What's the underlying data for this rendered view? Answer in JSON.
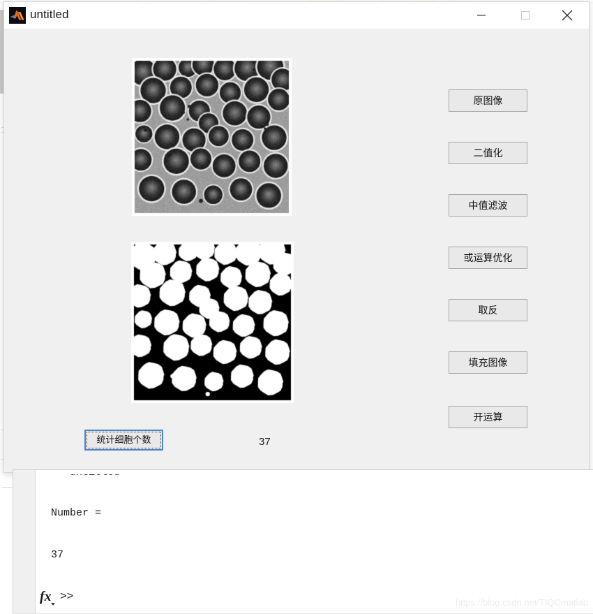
{
  "window": {
    "title": "untitled",
    "icon": "matlab-logo-icon",
    "controls": {
      "minimize": "minimize-icon",
      "maximize": "maximize-icon",
      "close": "close-icon"
    }
  },
  "figure": {
    "images": [
      {
        "name": "original-blood-cells-image",
        "caption": ""
      },
      {
        "name": "binary-segmented-cells-image",
        "caption": ""
      }
    ],
    "buttons": [
      {
        "label": "原图像"
      },
      {
        "label": "二值化"
      },
      {
        "label": "中值滤波"
      },
      {
        "label": "或运算优化"
      },
      {
        "label": "取反"
      },
      {
        "label": "填充图像"
      },
      {
        "label": "开运算"
      }
    ],
    "count_button": {
      "label": "统计细胞个数",
      "focused": true
    },
    "count_value": "37"
  },
  "command_window": {
    "clipped_line": ">> untitled",
    "result_label": "Number =",
    "result_value": "37",
    "prompt": ">>",
    "fx_symbol": "fx"
  },
  "watermark": "https://blog.csdn.net/TIQCmatlab",
  "colors": {
    "focus_border": "#4a86c8",
    "button_face": "#e9e9e9",
    "figure_background": "#f0f0f0",
    "titlebar": "#ffffff"
  }
}
